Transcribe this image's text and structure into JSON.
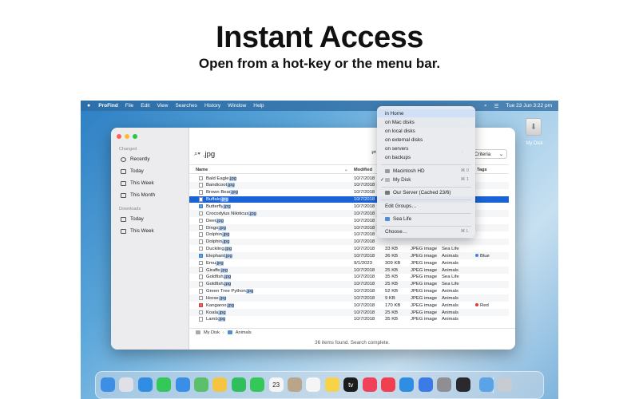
{
  "hero": {
    "title": "Instant Access",
    "subtitle": "Open from a hot-key or the menu bar."
  },
  "menubar": {
    "app_name": "ProFind",
    "items": [
      "File",
      "Edit",
      "View",
      "Searches",
      "History",
      "Window",
      "Help"
    ],
    "clock": "Tue 23 Jun  3:22 pm",
    "icons": [
      "apple-icon",
      "search-icon",
      "control-center-icon"
    ]
  },
  "desktop": {
    "disk_label": "My Disk"
  },
  "sidebar": {
    "changed_header": "Changed",
    "changed_items": [
      {
        "label": "Recently",
        "icon": "clock-icon"
      },
      {
        "label": "Today",
        "icon": "calendar-icon"
      },
      {
        "label": "This Week",
        "icon": "calendar-icon"
      },
      {
        "label": "This Month",
        "icon": "calendar-icon"
      }
    ],
    "downloads_header": "Downloads",
    "downloads_items": [
      {
        "label": "Today",
        "icon": "calendar-icon"
      },
      {
        "label": "This Week",
        "icon": "calendar-icon"
      }
    ]
  },
  "toolbar": {
    "search_query": ".jpg",
    "criteria_label": "Criteria"
  },
  "table": {
    "columns": {
      "name": "Name",
      "modified": "Modified",
      "tags": "Tags"
    },
    "rows": [
      {
        "base": "Bald Eagle",
        "ext": ".jpg",
        "modified": "10/7/2018",
        "size": "",
        "kind": "",
        "folder": "",
        "tag": "",
        "tag_color": "",
        "file_color": ""
      },
      {
        "base": "Bandicoot",
        "ext": ".jpg",
        "modified": "10/7/2018",
        "size": "",
        "kind": "",
        "folder": "",
        "tag": "",
        "tag_color": "",
        "file_color": ""
      },
      {
        "base": "Brown Bear",
        "ext": ".jpg",
        "modified": "10/7/2018",
        "size": "",
        "kind": "",
        "folder": "",
        "tag": "",
        "tag_color": "",
        "file_color": ""
      },
      {
        "base": "Buffalo",
        "ext": ".jpg",
        "modified": "10/7/2018",
        "size": "",
        "kind": "",
        "folder": "",
        "tag": "",
        "tag_color": "",
        "file_color": "",
        "selected": true
      },
      {
        "base": "Butterfly",
        "ext": ".jpg",
        "modified": "10/7/2018",
        "size": "",
        "kind": "",
        "folder": "",
        "tag": "",
        "tag_color": "",
        "file_color": "blue"
      },
      {
        "base": "Crocodylus Niloticus",
        "ext": ".jpg",
        "modified": "10/7/2018",
        "size": "",
        "kind": "",
        "folder": "",
        "tag": "",
        "tag_color": "",
        "file_color": ""
      },
      {
        "base": "Deer",
        "ext": ".jpg",
        "modified": "10/7/2018",
        "size": "",
        "kind": "",
        "folder": "",
        "tag": "",
        "tag_color": "",
        "file_color": ""
      },
      {
        "base": "Dingo",
        "ext": ".jpg",
        "modified": "10/7/2018",
        "size": "",
        "kind": "",
        "folder": "",
        "tag": "",
        "tag_color": "",
        "file_color": ""
      },
      {
        "base": "Dolphin",
        "ext": ".jpg",
        "modified": "10/7/2018",
        "size": "",
        "kind": "",
        "folder": "",
        "tag": "",
        "tag_color": "",
        "file_color": ""
      },
      {
        "base": "Dolphin",
        "ext": ".jpg",
        "modified": "10/7/2018",
        "size": "",
        "kind": "",
        "folder": "",
        "tag": "",
        "tag_color": "",
        "file_color": ""
      },
      {
        "base": "Duckling",
        "ext": ".jpg",
        "modified": "10/7/2018",
        "size": "33 KB",
        "kind": "JPEG image",
        "folder": "Sea Life",
        "tag": "",
        "tag_color": "",
        "file_color": ""
      },
      {
        "base": "Elephant",
        "ext": ".jpg",
        "modified": "10/7/2018",
        "size": "36 KB",
        "kind": "JPEG image",
        "folder": "Animals",
        "tag": "Blue",
        "tag_color": "#3b82f6",
        "file_color": "blue"
      },
      {
        "base": "Emu",
        "ext": ".jpg",
        "modified": "9/1/2023",
        "size": "309 KB",
        "kind": "JPEG image",
        "folder": "Animals",
        "tag": "",
        "tag_color": "",
        "file_color": ""
      },
      {
        "base": "Giraffe",
        "ext": ".jpg",
        "modified": "10/7/2018",
        "size": "25 KB",
        "kind": "JPEG image",
        "folder": "Animals",
        "tag": "",
        "tag_color": "",
        "file_color": ""
      },
      {
        "base": "Goldfish",
        "ext": ".jpg",
        "modified": "10/7/2018",
        "size": "35 KB",
        "kind": "JPEG image",
        "folder": "Sea Life",
        "tag": "",
        "tag_color": "",
        "file_color": ""
      },
      {
        "base": "Goldfish",
        "ext": ".jpg",
        "modified": "10/7/2018",
        "size": "25 KB",
        "kind": "JPEG image",
        "folder": "Sea Life",
        "tag": "",
        "tag_color": "",
        "file_color": ""
      },
      {
        "base": "Green Tree Python",
        "ext": ".jpg",
        "modified": "10/7/2018",
        "size": "52 KB",
        "kind": "JPEG image",
        "folder": "Animals",
        "tag": "",
        "tag_color": "",
        "file_color": ""
      },
      {
        "base": "Horse",
        "ext": ".jpg",
        "modified": "10/7/2018",
        "size": "9 KB",
        "kind": "JPEG image",
        "folder": "Animals",
        "tag": "",
        "tag_color": "",
        "file_color": ""
      },
      {
        "base": "Kangaroo",
        "ext": ".jpg",
        "modified": "10/7/2018",
        "size": "170 KB",
        "kind": "JPEG image",
        "folder": "Animals",
        "tag": "Red",
        "tag_color": "#e53935",
        "file_color": "red"
      },
      {
        "base": "Koala",
        "ext": ".jpg",
        "modified": "10/7/2018",
        "size": "25 KB",
        "kind": "JPEG image",
        "folder": "Animals",
        "tag": "",
        "tag_color": "",
        "file_color": ""
      },
      {
        "base": "Lamb",
        "ext": ".jpg",
        "modified": "10/7/2018",
        "size": "35 KB",
        "kind": "JPEG image",
        "folder": "Animals",
        "tag": "",
        "tag_color": "",
        "file_color": ""
      }
    ]
  },
  "pathbar": {
    "disk": "My Disk",
    "folder": "Animals"
  },
  "status": "36 items found. Search complete.",
  "menu": {
    "scopes": [
      "in Home",
      "on Mac disks",
      "on local disks",
      "on external disks",
      "on servers",
      "on backups"
    ],
    "disks": [
      {
        "label": "Macintosh HD",
        "shortcut": "⌘ 0",
        "checked": false
      },
      {
        "label": "My Disk",
        "shortcut": "⌘ 1",
        "checked": true
      }
    ],
    "server": "Our Server (Cached 23/6)",
    "edit_groups": "Edit Groups…",
    "group": "Sea Life",
    "choose": "Choose…",
    "choose_shortcut": "⌘ L"
  },
  "colors": {
    "selection": "#1a63d6",
    "accent": "#1a63d6"
  },
  "dock": {
    "apps": [
      {
        "name": "finder-icon",
        "color": "#3d8fe6"
      },
      {
        "name": "launchpad-icon",
        "color": "#e0e0e6"
      },
      {
        "name": "safari-icon",
        "color": "#2f8de4"
      },
      {
        "name": "messages-icon",
        "color": "#34c759"
      },
      {
        "name": "mail-icon",
        "color": "#3a8ee6"
      },
      {
        "name": "maps-icon",
        "color": "#5cc06a"
      },
      {
        "name": "photos-icon",
        "color": "#f5c542"
      },
      {
        "name": "facetime-icon",
        "color": "#2fbf5c"
      },
      {
        "name": "phone-icon",
        "color": "#34c759"
      },
      {
        "name": "calendar-icon",
        "color": "#f5f5f5"
      },
      {
        "name": "contacts-icon",
        "color": "#b9a58a"
      },
      {
        "name": "reminders-icon",
        "color": "#f5f5f5"
      },
      {
        "name": "notes-icon",
        "color": "#f7d34a"
      },
      {
        "name": "tv-icon",
        "color": "#1c1c1e"
      },
      {
        "name": "music-icon",
        "color": "#f0405a"
      },
      {
        "name": "news-icon",
        "color": "#f04050"
      },
      {
        "name": "app-store-icon",
        "color": "#2f8de4"
      },
      {
        "name": "keynote-icon",
        "color": "#3a7be6"
      },
      {
        "name": "system-settings-icon",
        "color": "#8e8e93"
      },
      {
        "name": "profind-icon",
        "color": "#2a2a2e"
      },
      {
        "name": "downloads-folder-icon",
        "color": "#5aa3e6"
      },
      {
        "name": "trash-icon",
        "color": "#c8ccd2"
      }
    ],
    "calendar_day": "23",
    "tv_label": "tv"
  }
}
